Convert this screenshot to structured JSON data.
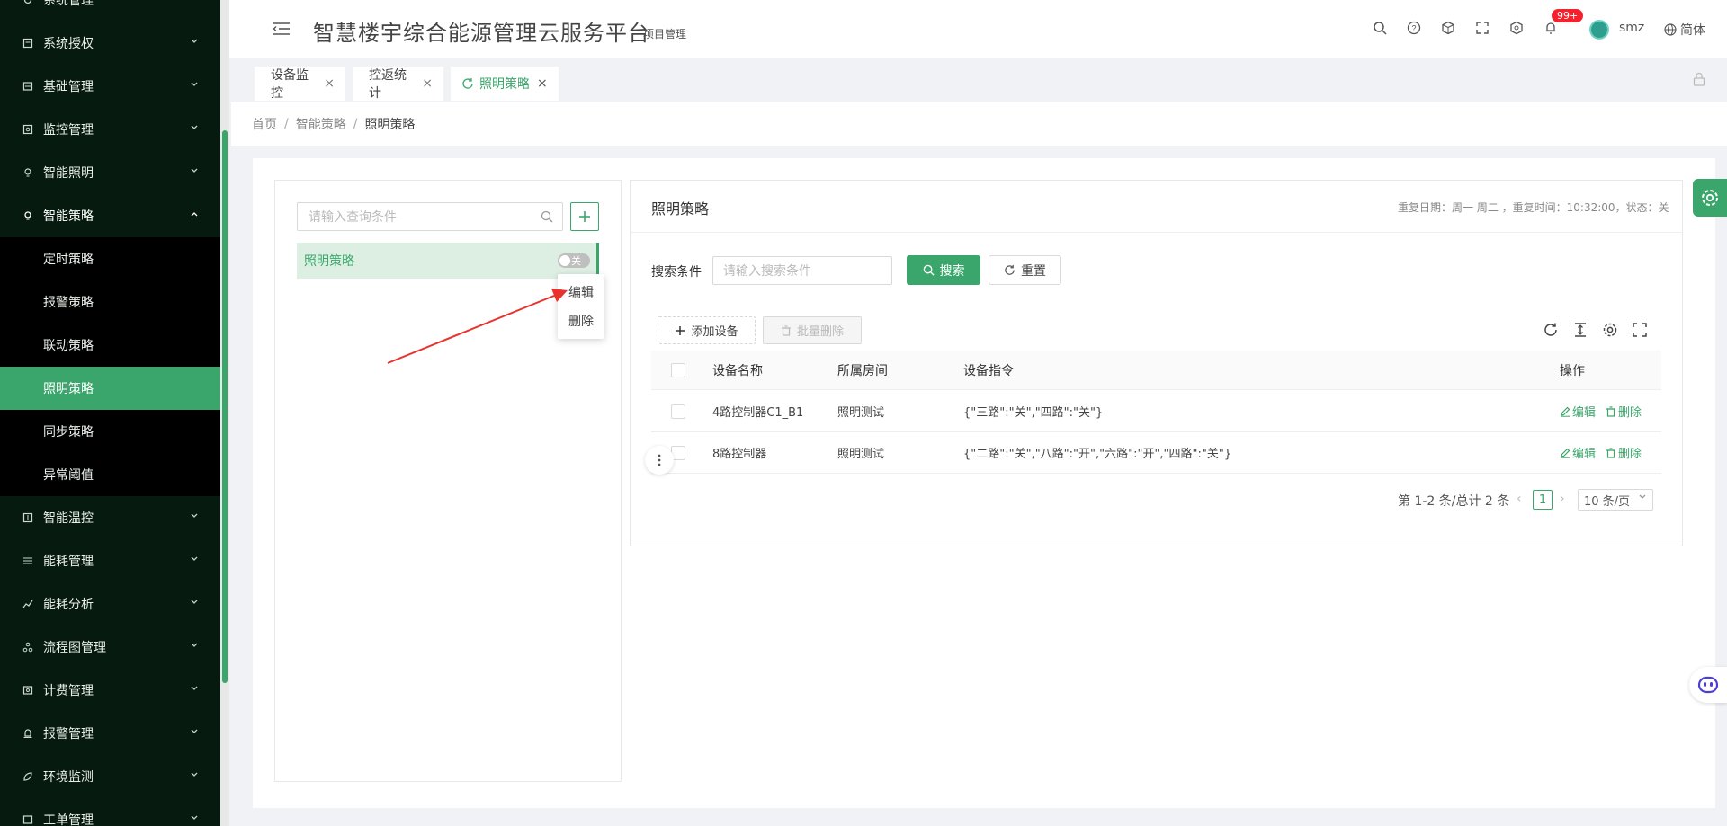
{
  "header": {
    "title": "智慧楼宇综合能源管理云服务平台",
    "subtitle": "项目管理",
    "notification_badge": "99+",
    "username": "smz",
    "language": "简体"
  },
  "sidebar": {
    "items": [
      {
        "label": "系统管理",
        "icon": "gear-icon"
      },
      {
        "label": "系统授权",
        "icon": "license-icon"
      },
      {
        "label": "基础管理",
        "icon": "database-icon"
      },
      {
        "label": "监控管理",
        "icon": "monitor-icon"
      },
      {
        "label": "智能照明",
        "icon": "bulb-icon"
      },
      {
        "label": "智能策略",
        "icon": "strategy-icon",
        "expanded": true
      },
      {
        "label": "智能温控",
        "icon": "thermo-icon"
      },
      {
        "label": "能耗管理",
        "icon": "sliders-icon"
      },
      {
        "label": "能耗分析",
        "icon": "chart-icon"
      },
      {
        "label": "流程图管理",
        "icon": "flow-icon"
      },
      {
        "label": "计费管理",
        "icon": "billing-icon"
      },
      {
        "label": "报警管理",
        "icon": "alarm-icon"
      },
      {
        "label": "环境监测",
        "icon": "leaf-icon"
      },
      {
        "label": "工单管理",
        "icon": "ticket-icon"
      }
    ],
    "sub_items": [
      {
        "label": "定时策略"
      },
      {
        "label": "报警策略"
      },
      {
        "label": "联动策略"
      },
      {
        "label": "照明策略",
        "active": true
      },
      {
        "label": "同步策略"
      },
      {
        "label": "异常阈值"
      }
    ]
  },
  "tabs": [
    {
      "label": "设备监控"
    },
    {
      "label": "控返统计"
    },
    {
      "label": "照明策略",
      "active": true
    }
  ],
  "breadcrumb": [
    "首页",
    "智能策略",
    "照明策略"
  ],
  "left": {
    "search_placeholder": "请输入查询条件",
    "tree_item": "照明策略",
    "switch_label": "关",
    "context_menu": [
      "编辑",
      "删除"
    ]
  },
  "right": {
    "title": "照明策略",
    "info": "重复日期：周一 周二 ，重复时间：10:32:00，状态：关",
    "search_label": "搜索条件",
    "search_placeholder": "请输入搜索条件",
    "search_btn": "搜索",
    "reset_btn": "重置",
    "add_device_btn": "添加设备",
    "batch_delete_btn": "批量删除",
    "columns": [
      "设备名称",
      "所属房间",
      "设备指令",
      "操作"
    ],
    "rows": [
      {
        "name": "4路控制器C1_B1",
        "room": "照明测试",
        "cmd": "{\"三路\":\"关\",\"四路\":\"关\"}"
      },
      {
        "name": "8路控制器",
        "room": "照明测试",
        "cmd": "{\"二路\":\"关\",\"八路\":\"开\",\"六路\":\"开\",\"四路\":\"关\"}"
      }
    ],
    "edit_label": "编辑",
    "delete_label": "删除",
    "pager_total": "第 1-2 条/总计 2 条",
    "pager_page": "1",
    "pager_size": "10 条/页"
  },
  "colors": {
    "accent": "#3aa66b",
    "sidebar_bg": "#071a0f",
    "badge": "#f5222d"
  }
}
